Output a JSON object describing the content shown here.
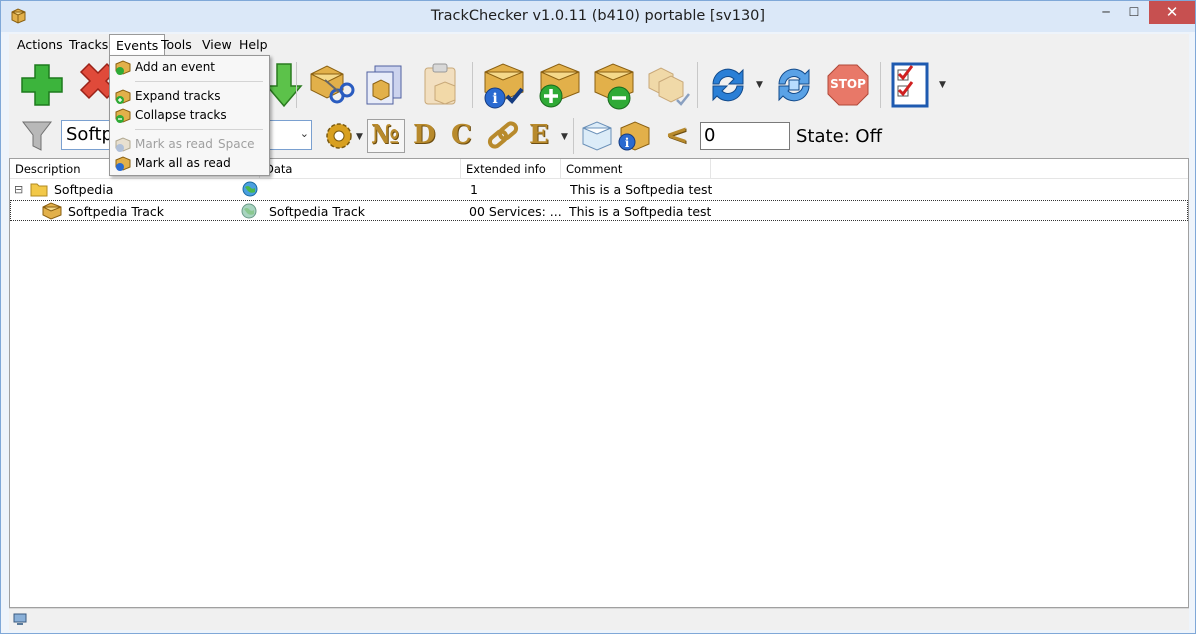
{
  "window": {
    "title": "TrackChecker v1.0.11 (b410)  portable [sv130]",
    "minimize": "─",
    "maximize": "☐",
    "close": "✕"
  },
  "menu": {
    "items": [
      "Actions",
      "Tracks",
      "Events",
      "Tools",
      "View",
      "Help"
    ],
    "active": "Events"
  },
  "events_menu": {
    "items": [
      {
        "label": "Add an event",
        "icon": "box-add-icon",
        "enabled": true
      },
      {
        "label": "Expand tracks",
        "icon": "expand-icon",
        "enabled": true
      },
      {
        "label": "Collapse tracks",
        "icon": "collapse-icon",
        "enabled": true
      },
      {
        "label": "Mark as read",
        "shortcut": "Space",
        "icon": "mark-read-icon",
        "enabled": false
      },
      {
        "label": "Mark all as read",
        "icon": "mark-all-read-icon",
        "enabled": true
      }
    ]
  },
  "toolbar": {
    "filter_value": "Softpe",
    "number_value": "0",
    "state_label": "State: Off",
    "letters": [
      "№",
      "D",
      "C",
      "E"
    ],
    "compare_symbol": "<",
    "stop_label": "STOP"
  },
  "table": {
    "columns": [
      "Description",
      "Data",
      "Extended info",
      "Comment"
    ],
    "rows": [
      {
        "expander": "⊟",
        "description": "Softpedia",
        "data": "",
        "extended": "1",
        "comment": "This is a Softpedia test"
      },
      {
        "expander": "",
        "description": "Softpedia Track",
        "data": "Softpedia Track",
        "extended": "00 Services: ...",
        "comment": "This is a Softpedia test"
      }
    ]
  },
  "colors": {
    "accent_green": "#3cb43c",
    "accent_red": "#e04a3a",
    "box_gold": "#d9a441",
    "refresh_blue": "#2a7fd6",
    "stop_red": "#e06050"
  }
}
